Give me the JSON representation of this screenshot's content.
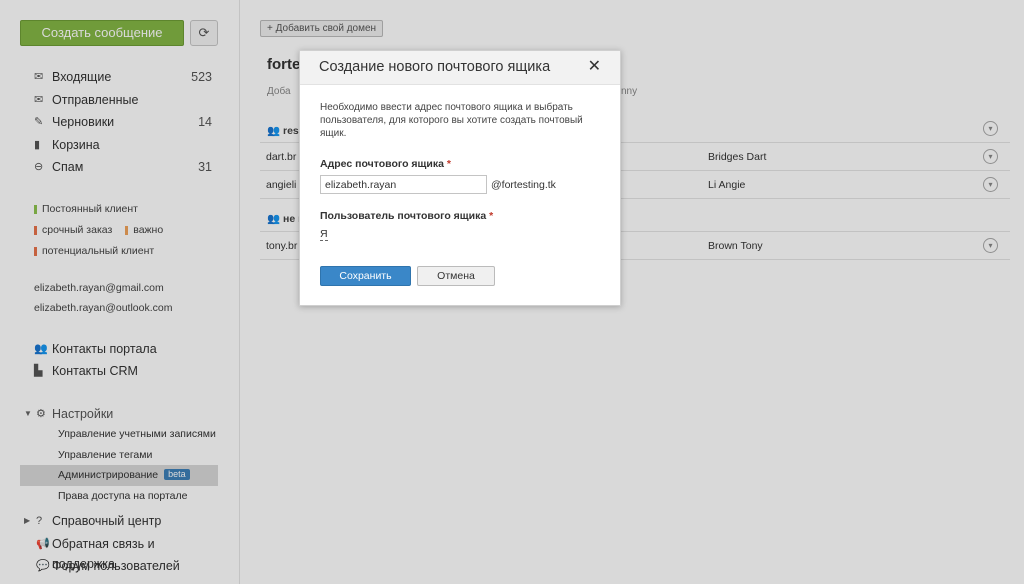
{
  "sidebar": {
    "create_label": "Создать сообщение",
    "refresh_icon": "refresh-icon",
    "folders": [
      {
        "label": "Входящие",
        "count": "523",
        "icon": "inbox-icon"
      },
      {
        "label": "Отправленные",
        "count": "",
        "icon": "sent-icon"
      },
      {
        "label": "Черновики",
        "count": "14",
        "icon": "drafts-icon"
      },
      {
        "label": "Корзина",
        "count": "",
        "icon": "trash-icon"
      },
      {
        "label": "Спам",
        "count": "31",
        "icon": "spam-icon"
      }
    ],
    "tags": [
      {
        "label": "Постоянный клиент",
        "color": "#8ec44e"
      },
      {
        "label": "срочный заказ",
        "color": "#e8734a"
      },
      {
        "label": "важно",
        "color": "#f0a35a"
      },
      {
        "label": "потенциальный клиент",
        "color": "#e8734a"
      }
    ],
    "accounts": [
      "elizabeth.rayan@gmail.com",
      "elizabeth.rayan@outlook.com"
    ],
    "contacts": [
      {
        "label": "Контакты портала",
        "icon": "people-icon"
      },
      {
        "label": "Контакты CRM",
        "icon": "crm-icon"
      }
    ],
    "settings": {
      "label": "Настройки",
      "items": [
        {
          "label": "Управление учетными записями"
        },
        {
          "label": "Управление тегами"
        },
        {
          "label": "Администрирование",
          "badge": "beta"
        },
        {
          "label": "Права доступа на портале"
        }
      ]
    },
    "help": [
      {
        "label": "Справочный центр",
        "icon": "question-icon"
      },
      {
        "label": "Обратная связь и поддержка",
        "icon": "megaphone-icon"
      },
      {
        "label": "Форум пользователей",
        "icon": "chat-icon"
      }
    ]
  },
  "main": {
    "add_domain_label": "+ Добавить свой домен",
    "domain_title": "forte",
    "domain_sub": "Доба",
    "domain_sub_right": "nny",
    "groups": [
      {
        "title": "rese",
        "rows": [
          {
            "address": "dart.br",
            "user": "Bridges Dart"
          },
          {
            "address": "angieli",
            "user": "Li Angie"
          }
        ]
      },
      {
        "title": "не в",
        "rows": [
          {
            "address": "tony.br",
            "user": "Brown Tony"
          }
        ]
      }
    ]
  },
  "modal": {
    "title": "Создание нового почтового ящика",
    "description": "Необходимо ввести адрес почтового ящика и выбрать пользователя, для которого вы хотите создать почтовый ящик.",
    "address_label": "Адрес почтового ящика",
    "address_value": "elizabeth.rayan",
    "domain_suffix": "@fortesting.tk",
    "user_label": "Пользователь почтового ящика",
    "user_value": "Я",
    "required_mark": "*",
    "save_label": "Сохранить",
    "cancel_label": "Отмена"
  }
}
